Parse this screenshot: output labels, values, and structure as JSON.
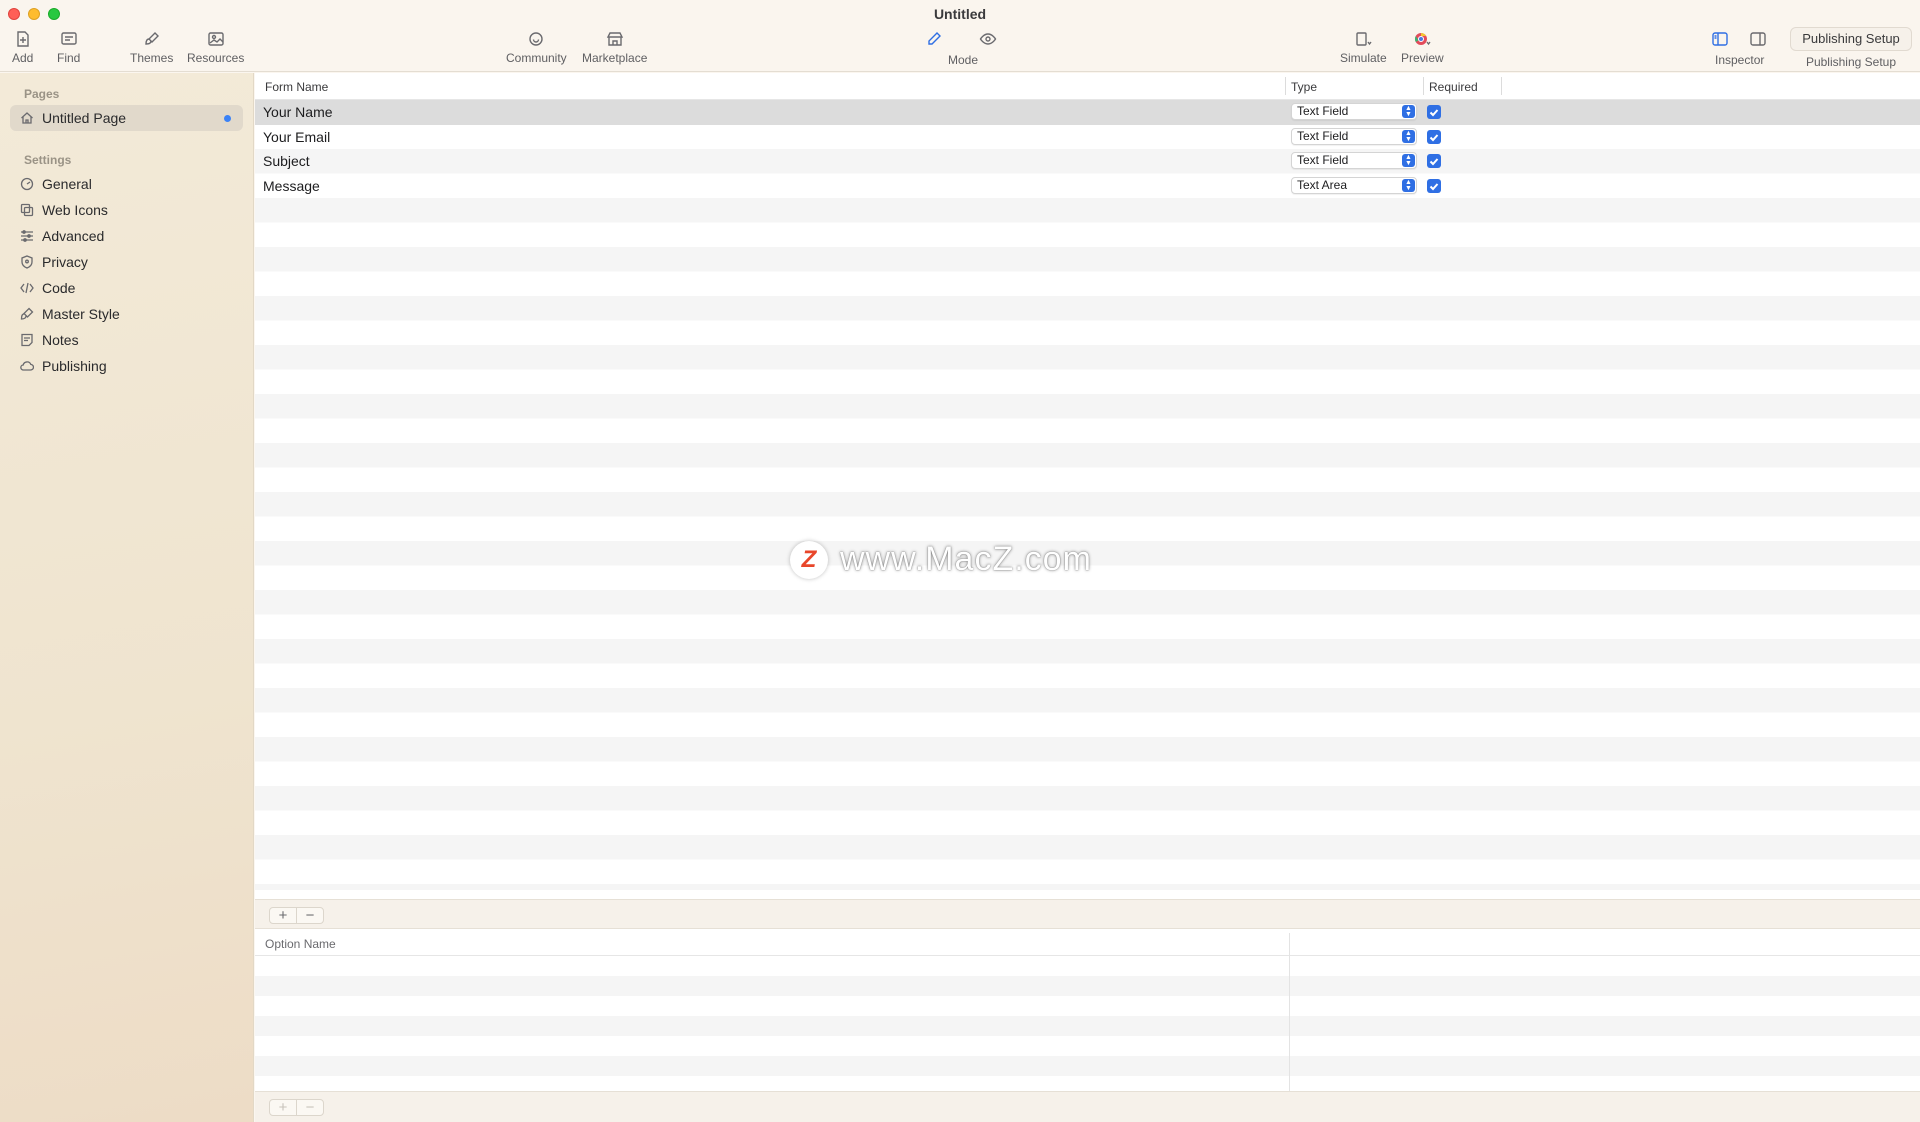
{
  "window": {
    "title": "Untitled"
  },
  "toolbar": {
    "add": "Add",
    "find": "Find",
    "themes": "Themes",
    "resources": "Resources",
    "community": "Community",
    "marketplace": "Marketplace",
    "mode": "Mode",
    "simulate": "Simulate",
    "preview": "Preview",
    "inspector": "Inspector",
    "publishing_setup_button": "Publishing Setup",
    "publishing_setup_label": "Publishing Setup"
  },
  "sidebar": {
    "pages_header": "Pages",
    "pages": [
      {
        "label": "Untitled Page",
        "selected": true
      }
    ],
    "settings_header": "Settings",
    "settings": [
      {
        "label": "General",
        "icon": "dashboard-icon"
      },
      {
        "label": "Web Icons",
        "icon": "web-icons-icon"
      },
      {
        "label": "Advanced",
        "icon": "sliders-icon"
      },
      {
        "label": "Privacy",
        "icon": "shield-icon"
      },
      {
        "label": "Code",
        "icon": "code-icon"
      },
      {
        "label": "Master Style",
        "icon": "brush-icon"
      },
      {
        "label": "Notes",
        "icon": "notes-icon"
      },
      {
        "label": "Publishing",
        "icon": "cloud-icon"
      }
    ]
  },
  "form_table": {
    "columns": [
      "Form Name",
      "Type",
      "Required"
    ],
    "rows": [
      {
        "name": "Your Name",
        "type": "Text Field",
        "required": true,
        "selected": true
      },
      {
        "name": "Your Email",
        "type": "Text Field",
        "required": true
      },
      {
        "name": "Subject",
        "type": "Text Field",
        "required": true
      },
      {
        "name": "Message",
        "type": "Text Area",
        "required": true
      }
    ]
  },
  "buttons": {
    "plus": "+",
    "minus": "−"
  },
  "options_table": {
    "columns": [
      "Option Name"
    ]
  },
  "watermark": {
    "logo": "Z",
    "text": "www.MacZ.com"
  },
  "colors": {
    "accent": "#2f6fe4",
    "selection": "#dcdcdc",
    "sidebar": "#f1e8d6"
  }
}
